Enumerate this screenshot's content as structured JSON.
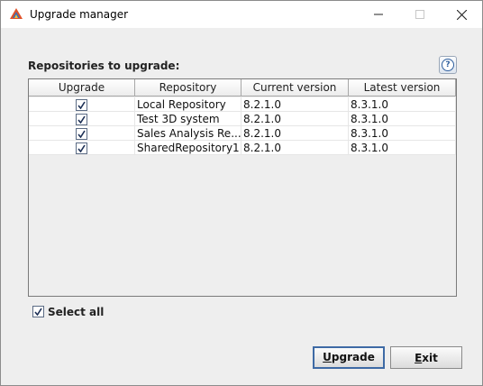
{
  "window": {
    "title": "Upgrade manager"
  },
  "section_label": "Repositories to upgrade:",
  "help_icon_text": "?",
  "table": {
    "headers": [
      "Upgrade",
      "Repository",
      "Current version",
      "Latest version"
    ],
    "rows": [
      {
        "checked": true,
        "repository": "Local Repository",
        "current": "8.2.1.0",
        "latest": "8.3.1.0"
      },
      {
        "checked": true,
        "repository": "Test 3D system",
        "current": "8.2.1.0",
        "latest": "8.3.1.0"
      },
      {
        "checked": true,
        "repository": "Sales Analysis Re...",
        "current": "8.2.1.0",
        "latest": "8.3.1.0"
      },
      {
        "checked": true,
        "repository": "SharedRepository1",
        "current": "8.2.1.0",
        "latest": "8.3.1.0"
      }
    ]
  },
  "select_all": {
    "label": "Select all",
    "checked": true
  },
  "buttons": {
    "upgrade_first": "U",
    "upgrade_rest": "pgrade",
    "exit_first": "E",
    "exit_rest": "xit"
  }
}
